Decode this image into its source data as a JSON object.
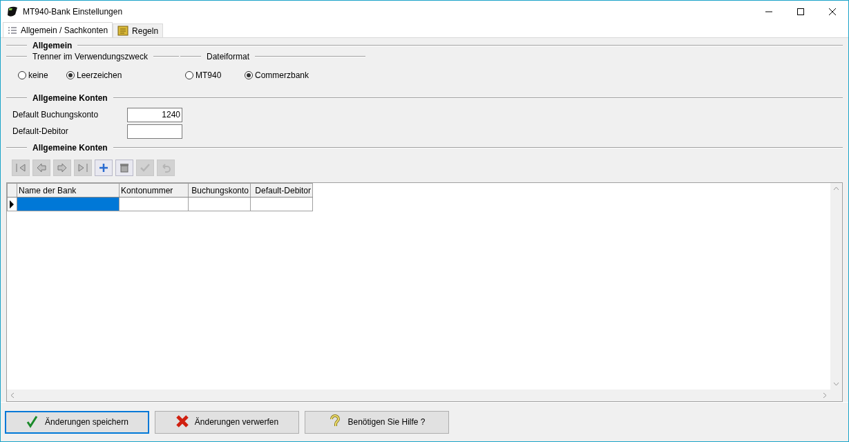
{
  "window": {
    "title": "MT940-Bank Einstellungen"
  },
  "tabs": [
    {
      "label": "Allgemein / Sachkonten",
      "selected": true,
      "kind": "list"
    },
    {
      "label": "Regeln",
      "selected": false,
      "kind": "rules"
    }
  ],
  "allgemein": {
    "title": "Allgemein",
    "groups": [
      {
        "title": "Trenner im Verwendungszweck",
        "options": [
          {
            "label": "keine",
            "selected": false
          },
          {
            "label": "Leerzeichen",
            "selected": true
          }
        ]
      },
      {
        "title": "Dateiformat",
        "options": [
          {
            "label": "MT940",
            "selected": false
          },
          {
            "label": "Commerzbank",
            "selected": true
          }
        ]
      }
    ]
  },
  "konten": {
    "title": "Allgemeine Konten",
    "fields": [
      {
        "label": "Default Buchungskonto",
        "value": "1240"
      },
      {
        "label": "Default-Debitor"
      }
    ]
  },
  "grid_section": {
    "title": "Allgemeine Konten",
    "navigator": [
      {
        "kind": "first",
        "disabled": true
      },
      {
        "kind": "prior",
        "disabled": true
      },
      {
        "kind": "next",
        "disabled": true
      },
      {
        "kind": "last",
        "disabled": true
      },
      {
        "kind": "insert",
        "disabled": false
      },
      {
        "kind": "delete",
        "disabled": false
      },
      {
        "kind": "post",
        "disabled": true
      },
      {
        "kind": "cancel",
        "disabled": true
      }
    ],
    "table": {
      "columns": [
        {
          "label": "Name der Bank",
          "right_aligned": false
        },
        {
          "label": "Kontonummer",
          "right_aligned": false
        },
        {
          "label": "Buchungskonto",
          "right_aligned": true
        },
        {
          "label": "Default-Debitor",
          "right_aligned": true
        }
      ],
      "rows": [
        {
          "selected": true
        }
      ]
    }
  },
  "buttons": [
    {
      "label": "Änderungen speichern",
      "kind": "save",
      "focused": true
    },
    {
      "label": "Änderungen verwerfen",
      "kind": "discard",
      "focused": false
    },
    {
      "label": "Benötigen Sie Hilfe ?",
      "kind": "help",
      "focused": false
    }
  ]
}
